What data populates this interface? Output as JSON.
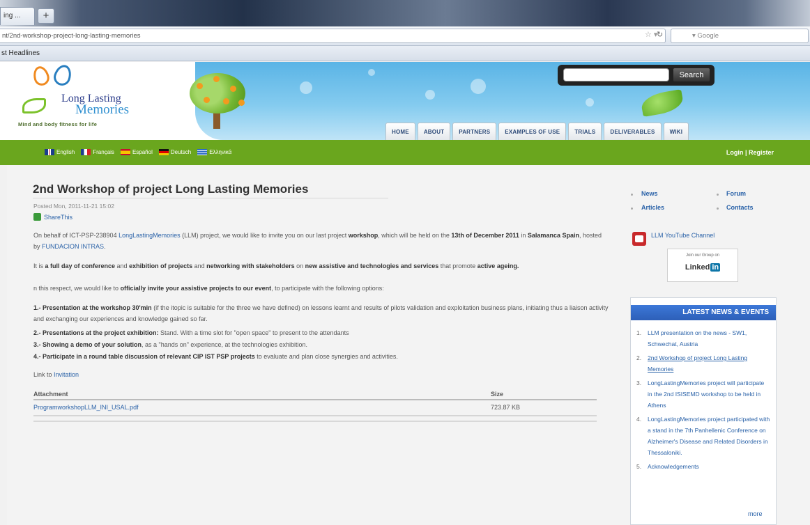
{
  "browser": {
    "tab_label": "ing ...",
    "newtab_label": "+",
    "url": "nt/2nd-workshop-project-long-lasting-memories",
    "google_placeholder": "Google",
    "bookmark_label": "st Headlines"
  },
  "header": {
    "logo_line1": "Long Lasting",
    "logo_line2": "Memories",
    "logo_tagline": "Mind and body fitness for life",
    "search_button": "Search",
    "nav": [
      "HOME",
      "ABOUT",
      "PARTNERS",
      "EXAMPLES OF USE",
      "TRIALS",
      "DELIVERABLES",
      "WIKI"
    ]
  },
  "langbar": {
    "languages": [
      "English",
      "Français",
      "Español",
      "Deutsch",
      "Ελληνικά"
    ],
    "login": "Login",
    "separator": "|",
    "register": "Register"
  },
  "article": {
    "title": "2nd Workshop of project Long Lasting Memories",
    "posted": "Posted Mon, 2011-11-21 15:02",
    "share": "ShareThis",
    "p1_a": "On behalf of ICT-PSP-238904 ",
    "p1_link": "LongLastingMemories",
    "p1_b": " (LLM) project, we would like to invite you on our last project ",
    "p1_bold1": "workshop",
    "p1_c": ", which will be held on the ",
    "p1_bold2": "13th of December 2011",
    "p1_d": " in ",
    "p1_bold3": "Salamanca Spain",
    "p1_e": ", hosted by ",
    "p1_link2": "FUNDACION INTRAS",
    "p1_f": ".",
    "p2_a": "It is ",
    "p2_bold1": "a full day of conference",
    "p2_b": " and ",
    "p2_bold2": "exhibition of projects",
    "p2_c": " and ",
    "p2_bold3": "networking with stakeholders",
    "p2_d": " on ",
    "p2_bold4": "new assistive and technologies and services",
    "p2_e": " that promote ",
    "p2_bold5": "active ageing.",
    "p3_a": "n this respect, we would like to ",
    "p3_bold": "officially invite your assistive projects to our event",
    "p3_b": ", to participate with the following options:",
    "o1_bold": "1.- Presentation at the workshop 30'min",
    "o1_text": " (if the itopic is suitable for the three we have defined) on lessons learnt and results of pilots validation and exploitation business plans, initiating thus a liaison activity and exchanging our experiences and knowledge gained so far.",
    "o2_bold": "2.- Presentations at the project exhibition:",
    "o2_text": " Stand. With a time slot for \"open space\" to present to the attendants",
    "o3_bold": "3.- Showing a demo of your solution",
    "o3_text": ", as a \"hands on\" experience, at the technologies exhibition.",
    "o4_bold": "4.- Participate in a round table discussion of relevant CIP IST PSP projects",
    "o4_text": " to evaluate and plan close synergies and activities.",
    "link_label": "Link to ",
    "link_text": "Invitation",
    "attach_header": "Attachment",
    "size_header": "Size",
    "file_name": "ProgramworkshopLLM_INI_USAL.pdf",
    "file_size": "723.87 KB"
  },
  "sidebar": {
    "links": [
      "News",
      "Forum",
      "Articles",
      "Contacts"
    ],
    "youtube": "LLM YouTube Channel",
    "linkedin_caption": "Join our Group on",
    "linkedin_word": "Linked",
    "linkedin_in": "in",
    "news_title": "LATEST NEWS & EVENTS",
    "news": [
      "LLM presentation on the news - SW1, Schwechat, Austria",
      "2nd Workshop of project Long Lasting Memories",
      "LongLastingMemories project will participate in the 2nd ISISEMD workshop to be held in Athens",
      "LongLastingMemories project participated with a stand in the 7th Panhellenic Conference on Alzheimer's Disease and Related Disorders in Thessaloniki.",
      "Acknowledgements"
    ],
    "more": "more"
  },
  "colors": {
    "green": "#6aa61e",
    "link": "#2a62a8",
    "news_header": "#3c78d8"
  }
}
